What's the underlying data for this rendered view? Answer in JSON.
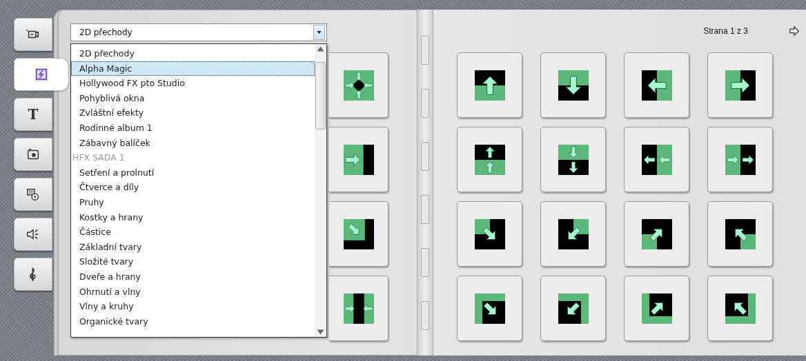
{
  "sidebar_tabs": [
    {
      "kind": "video",
      "selected": false
    },
    {
      "kind": "transitions",
      "selected": true
    },
    {
      "kind": "title",
      "label": "T",
      "selected": false
    },
    {
      "kind": "photo",
      "selected": false
    },
    {
      "kind": "disc-menu",
      "selected": false
    },
    {
      "kind": "audio",
      "selected": false
    },
    {
      "kind": "music",
      "selected": false
    }
  ],
  "category_select": {
    "value": "2D přechody",
    "expanded": true
  },
  "category_list": [
    {
      "kind": "option",
      "label": "2D přechody",
      "selected": false
    },
    {
      "kind": "option",
      "label": "Alpha Magic",
      "selected": true
    },
    {
      "kind": "option",
      "label": "Hollywood FX pto Studio",
      "selected": false
    },
    {
      "kind": "option",
      "label": "Pohyblivá okna",
      "selected": false
    },
    {
      "kind": "option",
      "label": "Zvláštní efekty",
      "selected": false
    },
    {
      "kind": "option",
      "label": "Rodinné album 1",
      "selected": false
    },
    {
      "kind": "option",
      "label": "Zábavný balíček",
      "selected": false
    },
    {
      "kind": "header",
      "label": "HFX SADA 1"
    },
    {
      "kind": "option",
      "label": "Setření a prolnutí",
      "selected": false
    },
    {
      "kind": "option",
      "label": "Čtverce a díly",
      "selected": false
    },
    {
      "kind": "option",
      "label": "Pruhy",
      "selected": false
    },
    {
      "kind": "option",
      "label": "Kostky a hrany",
      "selected": false
    },
    {
      "kind": "option",
      "label": "Částice",
      "selected": false
    },
    {
      "kind": "option",
      "label": "Základní tvary",
      "selected": false
    },
    {
      "kind": "option",
      "label": "Složité tvary",
      "selected": false
    },
    {
      "kind": "option",
      "label": "Dveře a hrany",
      "selected": false
    },
    {
      "kind": "option",
      "label": "Ohrnutí a vlny",
      "selected": false
    },
    {
      "kind": "option",
      "label": "Vlny a kruhy",
      "selected": false
    },
    {
      "kind": "option",
      "label": "Organické tvary",
      "selected": false
    }
  ],
  "page_indicator": "Strana 1 z 3"
}
